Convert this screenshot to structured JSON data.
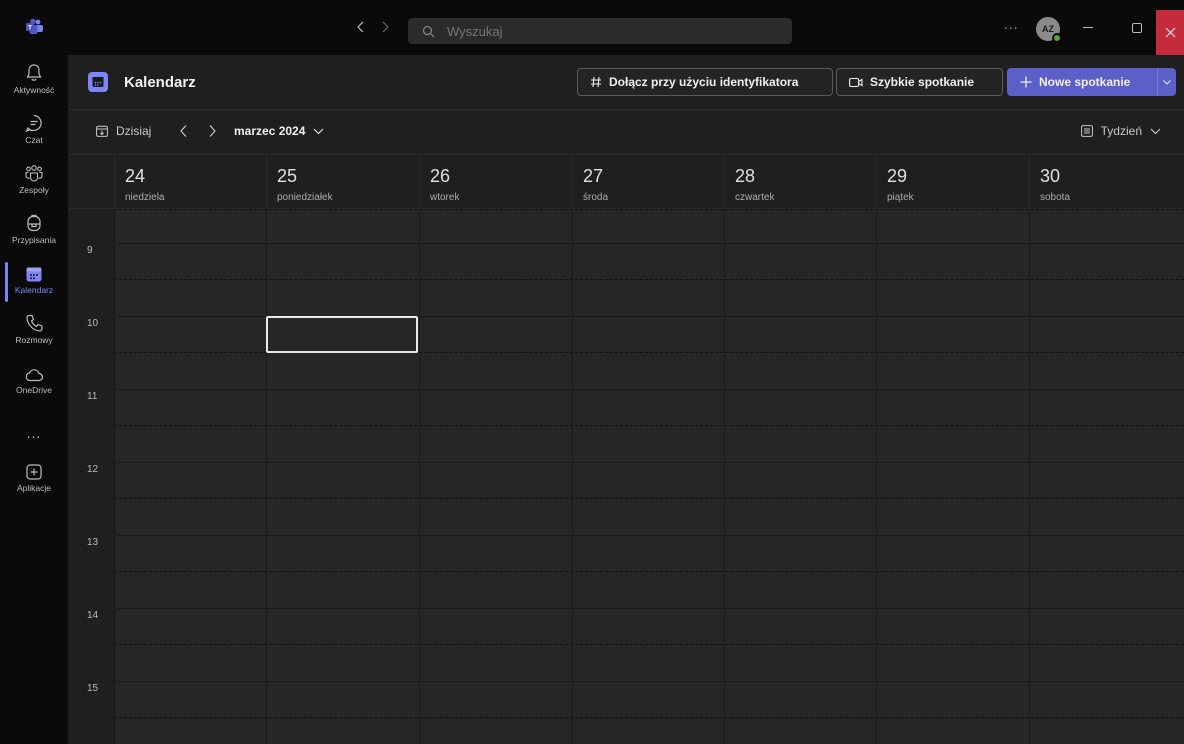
{
  "titlebar": {
    "search_placeholder": "Wyszukaj",
    "more": "...",
    "avatar_initials": "AZ"
  },
  "rail": {
    "items": [
      {
        "label": "Aktywność",
        "icon": "bell-icon"
      },
      {
        "label": "Czat",
        "icon": "chat-icon"
      },
      {
        "label": "Zespoły",
        "icon": "teams-icon"
      },
      {
        "label": "Przypisania",
        "icon": "backpack-icon"
      },
      {
        "label": "Kalendarz",
        "icon": "calendar-icon"
      },
      {
        "label": "Rozmowy",
        "icon": "phone-icon"
      },
      {
        "label": "OneDrive",
        "icon": "cloud-icon"
      },
      {
        "label": "Aplikacje",
        "icon": "add-apps-icon"
      }
    ],
    "more": "...",
    "active": "Kalendarz"
  },
  "header": {
    "title": "Kalendarz",
    "join_label": "Dołącz przy użyciu identyfikatora",
    "quick_label": "Szybkie spotkanie",
    "new_label": "Nowe spotkanie"
  },
  "toolbar": {
    "today_label": "Dzisiaj",
    "month_label": "marzec 2024",
    "view_label": "Tydzień"
  },
  "calendar": {
    "days": [
      {
        "num": "24",
        "name": "niedziela"
      },
      {
        "num": "25",
        "name": "poniedziałek"
      },
      {
        "num": "26",
        "name": "wtorek"
      },
      {
        "num": "27",
        "name": "środa"
      },
      {
        "num": "28",
        "name": "czwartek"
      },
      {
        "num": "29",
        "name": "piątek"
      },
      {
        "num": "30",
        "name": "sobota"
      }
    ],
    "hours": [
      "9",
      "10",
      "11",
      "12",
      "13",
      "14",
      "15"
    ]
  },
  "colors": {
    "accent": "#7f85f5",
    "primary_button": "#5b5fc7",
    "close_button": "#c42b3c",
    "presence": "#5ea33d"
  }
}
